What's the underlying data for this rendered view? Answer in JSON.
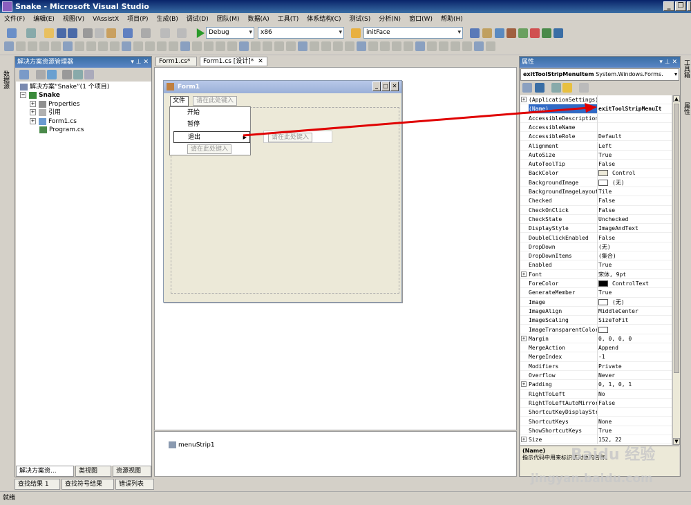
{
  "window": {
    "title": "Snake - Microsoft Visual Studio"
  },
  "menu": [
    "文件(F)",
    "编辑(E)",
    "视图(V)",
    "VAssistX",
    "项目(P)",
    "生成(B)",
    "调试(D)",
    "团队(M)",
    "数据(A)",
    "工具(T)",
    "体系结构(C)",
    "测试(S)",
    "分析(N)",
    "窗口(W)",
    "帮助(H)"
  ],
  "toolbar": {
    "config": "Debug",
    "platform": "x86",
    "find": "initFace"
  },
  "solution_explorer": {
    "title": "解决方案资源管理器",
    "solution": "解决方案“Snake”(1 个项目)",
    "project": "Snake",
    "items": [
      "Properties",
      "引用",
      "Form1.cs",
      "Program.cs"
    ],
    "tabs": [
      "解决方案资...",
      "类视图",
      "资源视图"
    ]
  },
  "left_strip": "数据源",
  "right_strip": [
    "工具箱",
    "属性"
  ],
  "editor": {
    "tabs": [
      "Form1.cs*",
      "Form1.cs [设计]*"
    ],
    "form_title": "Form1",
    "menu_file": "文件",
    "placeholder": "请在此处键入",
    "dropdown": [
      "开始",
      "暂停",
      "退出"
    ],
    "component": "menuStrip1"
  },
  "properties": {
    "title": "属性",
    "object": "exitToolStripMenuItem",
    "type": "System.Windows.Forms.",
    "rows": [
      {
        "n": "(ApplicationSettings)",
        "v": "",
        "exp": true
      },
      {
        "n": "(Name)",
        "v": "exitToolStripMenuIt",
        "sel": true
      },
      {
        "n": "AccessibleDescription",
        "v": ""
      },
      {
        "n": "AccessibleName",
        "v": ""
      },
      {
        "n": "AccessibleRole",
        "v": "Default"
      },
      {
        "n": "Alignment",
        "v": "Left"
      },
      {
        "n": "AutoSize",
        "v": "True"
      },
      {
        "n": "AutoToolTip",
        "v": "False"
      },
      {
        "n": "BackColor",
        "v": "Control",
        "sw": "#ece9d8"
      },
      {
        "n": "BackgroundImage",
        "v": "(无)",
        "sw": "#ffffff"
      },
      {
        "n": "BackgroundImageLayout",
        "v": "Tile"
      },
      {
        "n": "Checked",
        "v": "False"
      },
      {
        "n": "CheckOnClick",
        "v": "False"
      },
      {
        "n": "CheckState",
        "v": "Unchecked"
      },
      {
        "n": "DisplayStyle",
        "v": "ImageAndText"
      },
      {
        "n": "DoubleClickEnabled",
        "v": "False"
      },
      {
        "n": "DropDown",
        "v": "(无)"
      },
      {
        "n": "DropDownItems",
        "v": "(集合)"
      },
      {
        "n": "Enabled",
        "v": "True"
      },
      {
        "n": "Font",
        "v": "宋体, 9pt",
        "exp": true
      },
      {
        "n": "ForeColor",
        "v": "ControlText",
        "sw": "#000000"
      },
      {
        "n": "GenerateMember",
        "v": "True"
      },
      {
        "n": "Image",
        "v": "(无)",
        "sw": "#ffffff"
      },
      {
        "n": "ImageAlign",
        "v": "MiddleCenter"
      },
      {
        "n": "ImageScaling",
        "v": "SizeToFit"
      },
      {
        "n": "ImageTransparentColor",
        "v": "",
        "sw": "#ffffff"
      },
      {
        "n": "Margin",
        "v": "0, 0, 0, 0",
        "exp": true
      },
      {
        "n": "MergeAction",
        "v": "Append"
      },
      {
        "n": "MergeIndex",
        "v": "-1"
      },
      {
        "n": "Modifiers",
        "v": "Private"
      },
      {
        "n": "Overflow",
        "v": "Never"
      },
      {
        "n": "Padding",
        "v": "0, 1, 0, 1",
        "exp": true
      },
      {
        "n": "RightToLeft",
        "v": "No"
      },
      {
        "n": "RightToLeftAutoMirror",
        "v": "False"
      },
      {
        "n": "ShortcutKeyDisplayStr",
        "v": ""
      },
      {
        "n": "ShortcutKeys",
        "v": "None"
      },
      {
        "n": "ShowShortcutKeys",
        "v": "True"
      },
      {
        "n": "Size",
        "v": "152, 22",
        "exp": true
      }
    ],
    "desc_title": "(Name)",
    "desc_text": "指示代码中用来标识该对象的名称。"
  },
  "bottom_tabs": [
    "查找结果 1",
    "查找符号结果",
    "错误列表"
  ],
  "status": "就绪",
  "watermark": {
    "brand": "Baidu 经验",
    "url": "jingyan.baidu.com"
  }
}
